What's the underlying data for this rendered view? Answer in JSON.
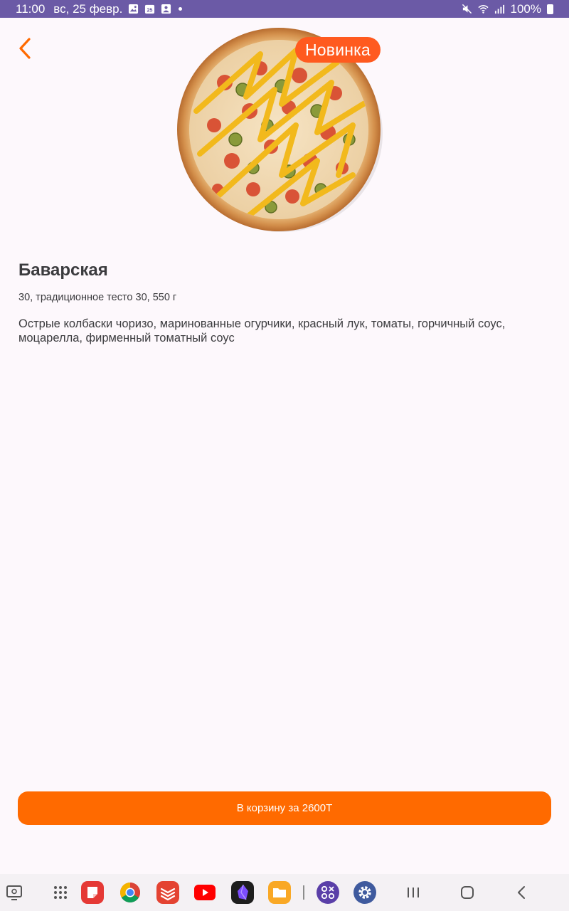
{
  "status_bar": {
    "time": "11:00",
    "date": "вс, 25 февр.",
    "battery": "100%",
    "calendar_day": "25"
  },
  "product": {
    "badge": "Новинка",
    "title": "Баварская",
    "meta": "30, традиционное тесто 30, 550 г",
    "description": "Острые колбаски чоризо, маринованные огурчики, красный лук, томаты, горчичный соус, моцарелла, фирменный томатный соус"
  },
  "cart_button": {
    "label": "В корзину за 2600Т"
  },
  "icons": {
    "back": "chevron-left-icon",
    "pizza": "pizza-image"
  },
  "colors": {
    "accent": "#ff6a00",
    "badge": "#ff5a1f",
    "status_bar": "#6b5aa6",
    "background": "#fdf8fc"
  },
  "nav_bar": {
    "apps": [
      "screen-recorder-icon",
      "app-drawer-icon",
      "notes-app-icon",
      "chrome-icon",
      "todoist-icon",
      "youtube-icon",
      "obsidian-icon",
      "files-icon",
      "calculator-app-icon",
      "settings-icon"
    ],
    "system": [
      "recents-icon",
      "home-icon",
      "back-icon"
    ]
  }
}
